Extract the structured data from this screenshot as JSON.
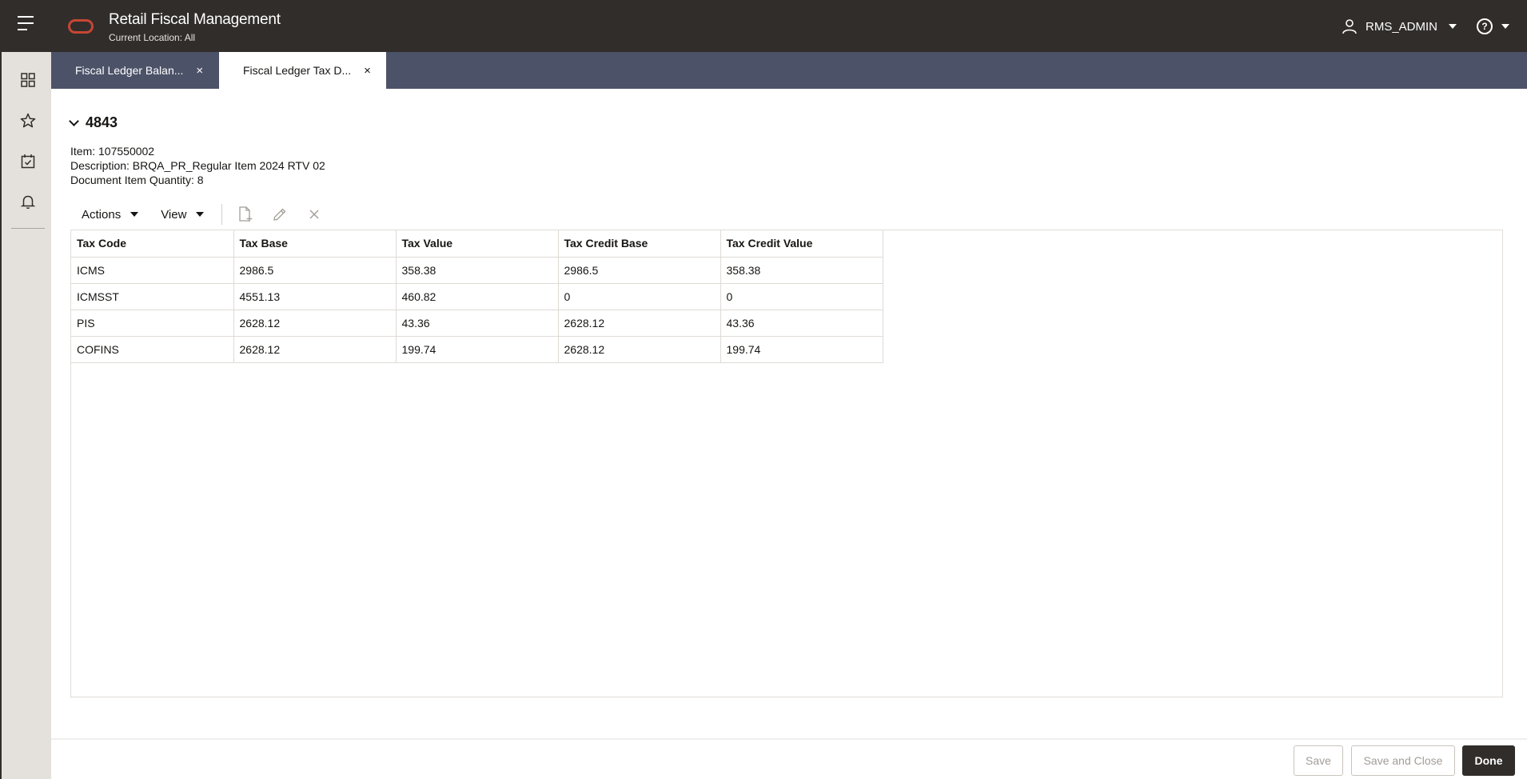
{
  "header": {
    "app_title": "Retail Fiscal Management",
    "location": "Current Location: All",
    "user": "RMS_ADMIN",
    "help_symbol": "?"
  },
  "rail": {
    "icons": [
      "dashboard-icon",
      "favorites-star-icon",
      "tasks-icon",
      "notifications-bell-icon"
    ]
  },
  "tabs": [
    {
      "label": "Fiscal Ledger Balan...",
      "active": false,
      "close": "×"
    },
    {
      "label": "Fiscal Ledger Tax D...",
      "active": true,
      "close": "×"
    }
  ],
  "detail": {
    "number": "4843",
    "item": "Item: 107550002",
    "description": "Description: BRQA_PR_Regular Item 2024 RTV 02",
    "quantity": "Document Item Quantity: 8"
  },
  "toolbar": {
    "actions_label": "Actions",
    "view_label": "View"
  },
  "table": {
    "columns": [
      "Tax Code",
      "Tax Base",
      "Tax Value",
      "Tax Credit Base",
      "Tax Credit Value"
    ],
    "rows": [
      [
        "ICMS",
        "2986.5",
        "358.38",
        "2986.5",
        "358.38"
      ],
      [
        "ICMSST",
        "4551.13",
        "460.82",
        "0",
        "0"
      ],
      [
        "PIS",
        "2628.12",
        "43.36",
        "2628.12",
        "43.36"
      ],
      [
        "COFINS",
        "2628.12",
        "199.74",
        "2628.12",
        "199.74"
      ]
    ]
  },
  "footer": {
    "save_label": "Save",
    "save_close_label": "Save and Close",
    "done_label": "Done"
  },
  "colors": {
    "header_bg": "#312d2a",
    "tabbar_bg": "#4c5268",
    "rail_bg": "#e4e1dc",
    "brand_red": "#c74634"
  }
}
